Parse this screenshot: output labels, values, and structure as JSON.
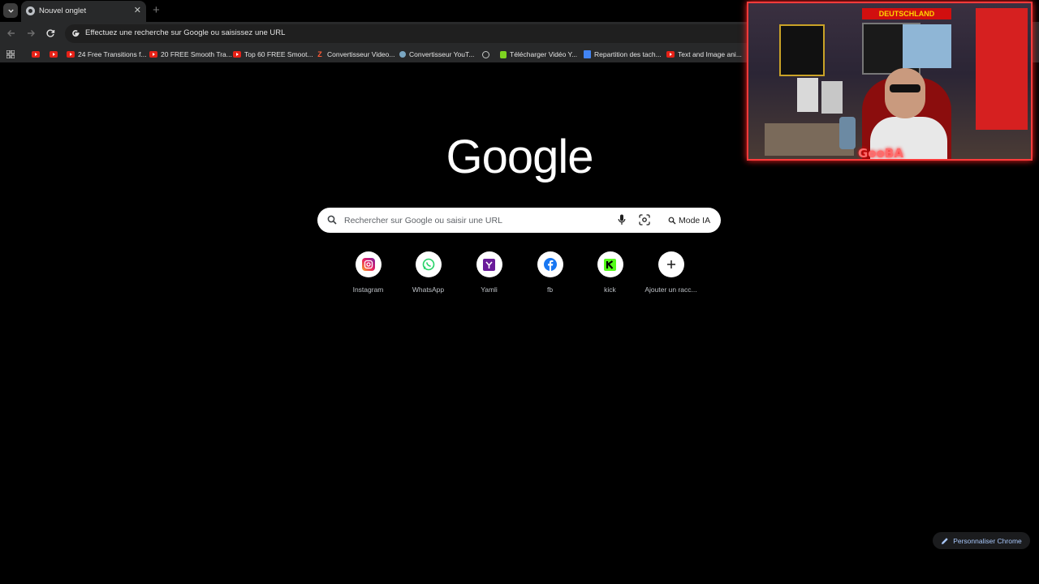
{
  "browser": {
    "tab": {
      "title": "Nouvel onglet",
      "close": "✕"
    },
    "new_tab": "+",
    "omnibox": {
      "text": "Effectuez une recherche sur Google ou saisissez une URL"
    },
    "bookmarks": [
      {
        "label": "",
        "icon": "youtube-icon"
      },
      {
        "label": "",
        "icon": "youtube-icon"
      },
      {
        "label": "24 Free Transitions f...",
        "icon": "youtube-icon"
      },
      {
        "label": "20 FREE Smooth Tra...",
        "icon": "youtube-icon"
      },
      {
        "label": "Top 60 FREE Smoot...",
        "icon": "youtube-icon"
      },
      {
        "label": "Convertisseur Video...",
        "icon": "z-icon"
      },
      {
        "label": "Convertisseur YouT...",
        "icon": "converter-icon"
      },
      {
        "label": "",
        "icon": "globe-icon"
      },
      {
        "label": "Télécharger Vidéo Y...",
        "icon": "download-icon"
      },
      {
        "label": "Repartition des tach...",
        "icon": "docs-icon"
      },
      {
        "label": "Text and Image ani...",
        "icon": "youtube-icon"
      }
    ]
  },
  "page": {
    "logo": "Google",
    "search": {
      "placeholder": "Rechercher sur Google ou saisir une URL",
      "mode_ia": "Mode IA"
    },
    "shortcuts": [
      {
        "label": "Instagram",
        "icon": "instagram-icon"
      },
      {
        "label": "WhatsApp",
        "icon": "whatsapp-icon"
      },
      {
        "label": "Yamli",
        "icon": "yamli-icon"
      },
      {
        "label": "fb",
        "icon": "facebook-icon"
      },
      {
        "label": "kick",
        "icon": "kick-icon"
      },
      {
        "label": "Ajouter un racc...",
        "icon": "plus-icon"
      }
    ],
    "customize": "Personnaliser Chrome"
  },
  "webcam": {
    "banner": "DEUTSCHLAND",
    "name": "GooBA"
  },
  "colors": {
    "background": "#000000",
    "chrome": "#28292a",
    "accent": "#a8c7fa",
    "youtube": "#e62117"
  }
}
